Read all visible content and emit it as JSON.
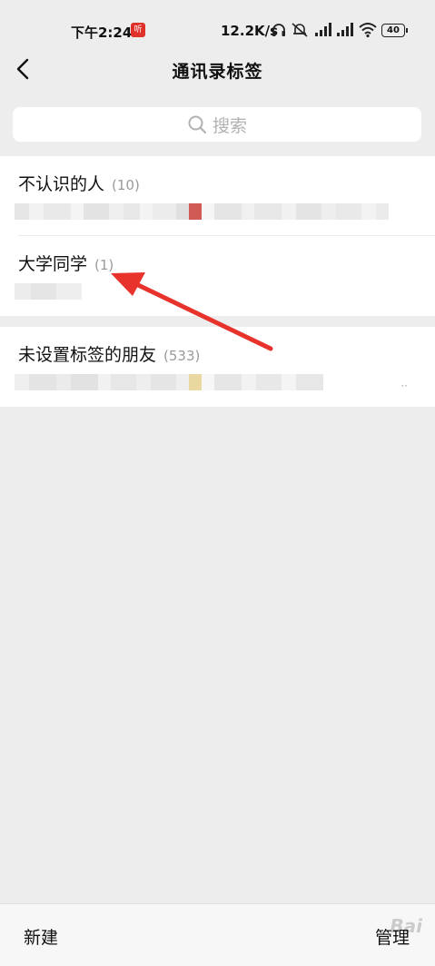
{
  "status_bar": {
    "time": "下午2:24",
    "app_badge": "听",
    "net_speed": "12.2K/s",
    "battery": "40"
  },
  "header": {
    "title": "通讯录标签"
  },
  "search": {
    "placeholder": "搜索"
  },
  "tags": [
    {
      "name": "不认识的人",
      "count": "(10)"
    },
    {
      "name": "大学同学",
      "count": "(1)"
    },
    {
      "name": "未设置标签的朋友",
      "count": "(533)"
    }
  ],
  "bottom_bar": {
    "new_label": "新建",
    "manage_label": "管理"
  },
  "colors": {
    "background": "#ededed",
    "card": "#ffffff",
    "muted": "#9a9a9a",
    "annotation": "#e8322c"
  }
}
